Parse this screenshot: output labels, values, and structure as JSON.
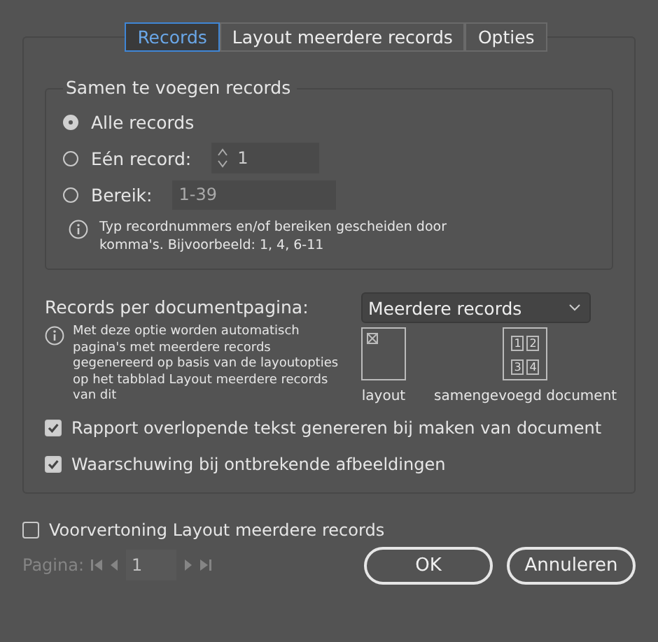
{
  "tabs": [
    {
      "label": "Records",
      "selected": true
    },
    {
      "label": "Layout meerdere records",
      "selected": false
    },
    {
      "label": "Opties",
      "selected": false
    }
  ],
  "merge_group": {
    "title": "Samen te voegen records",
    "options": [
      {
        "label": "Alle records",
        "selected": true
      },
      {
        "label": "Eén record:",
        "selected": false,
        "kind": "spinner",
        "value": "1"
      },
      {
        "label": "Bereik:",
        "selected": false,
        "kind": "field",
        "value": "1-39"
      }
    ],
    "hint": "Typ recordnummers en/of bereiken gescheiden door komma's. Bijvoorbeeld: 1, 4, 6-11"
  },
  "per_page": {
    "label": "Records per documentpagina:",
    "dropdown": "Meerdere records",
    "hint": "Met deze optie worden automatisch pagina's met meerdere records gegenereerd op basis van de layoutopties op het tabblad Layout meerdere records van dit",
    "diagram": {
      "layout_label": "layout",
      "merged_label": "samengevoegd document",
      "cells": [
        "1",
        "2",
        "3",
        "4"
      ]
    }
  },
  "checkboxes": [
    {
      "label": "Rapport overlopende tekst genereren bij maken van document",
      "checked": true
    },
    {
      "label": "Waarschuwing bij ontbrekende afbeeldingen",
      "checked": true
    }
  ],
  "preview": {
    "label": "Voorvertoning Layout meerdere records",
    "checked": false
  },
  "pager": {
    "label": "Pagina:",
    "value": "1",
    "disabled": true
  },
  "buttons": [
    "OK",
    "Annuleren"
  ]
}
